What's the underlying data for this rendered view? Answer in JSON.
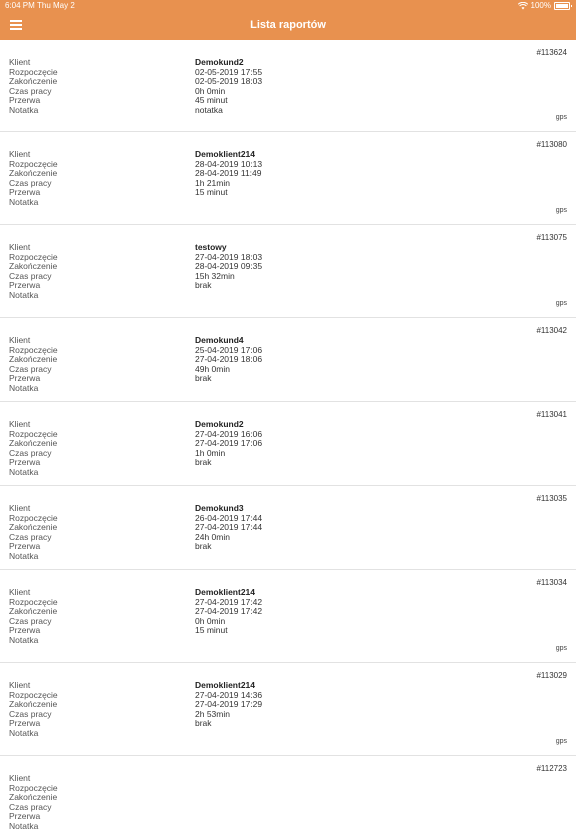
{
  "status": {
    "time": "6:04 PM",
    "date": "Thu May 2",
    "battery": "100%"
  },
  "header": {
    "title": "Lista raportów"
  },
  "labels": {
    "client": "Klient",
    "start": "Rozpoczęcie",
    "end": "Zakończenie",
    "work_time": "Czas pracy",
    "break": "Przerwa",
    "note": "Notatka"
  },
  "reports": [
    {
      "id": "#113624",
      "client": "Demokund2",
      "start": "02-05-2019 17:55",
      "end": "02-05-2019 18:03",
      "work_time": "0h 0min",
      "break": "45 minut",
      "note": "notatka",
      "gps": "gps"
    },
    {
      "id": "#113080",
      "client": "Demoklient214",
      "start": "28-04-2019 10:13",
      "end": "28-04-2019 11:49",
      "work_time": "1h 21min",
      "break": "15 minut",
      "note": "",
      "gps": "gps"
    },
    {
      "id": "#113075",
      "client": "testowy",
      "start": "27-04-2019 18:03",
      "end": "28-04-2019 09:35",
      "work_time": "15h 32min",
      "break": "brak",
      "note": "",
      "gps": "gps"
    },
    {
      "id": "#113042",
      "client": "Demokund4",
      "start": "25-04-2019 17:06",
      "end": "27-04-2019 18:06",
      "work_time": "49h 0min",
      "break": "brak",
      "note": "",
      "gps": ""
    },
    {
      "id": "#113041",
      "client": "Demokund2",
      "start": "27-04-2019 16:06",
      "end": "27-04-2019 17:06",
      "work_time": "1h 0min",
      "break": "brak",
      "note": "",
      "gps": ""
    },
    {
      "id": "#113035",
      "client": "Demokund3",
      "start": "26-04-2019 17:44",
      "end": "27-04-2019 17:44",
      "work_time": "24h 0min",
      "break": "brak",
      "note": "",
      "gps": ""
    },
    {
      "id": "#113034",
      "client": "Demoklient214",
      "start": "27-04-2019 17:42",
      "end": "27-04-2019 17:42",
      "work_time": "0h 0min",
      "break": "15 minut",
      "note": "",
      "gps": "gps"
    },
    {
      "id": "#113029",
      "client": "Demoklient214",
      "start": "27-04-2019 14:36",
      "end": "27-04-2019 17:29",
      "work_time": "2h 53min",
      "break": "brak",
      "note": "",
      "gps": "gps"
    },
    {
      "id": "#112723",
      "client": "",
      "start": "",
      "end": "",
      "work_time": "",
      "break": "",
      "note": "",
      "gps": ""
    }
  ]
}
